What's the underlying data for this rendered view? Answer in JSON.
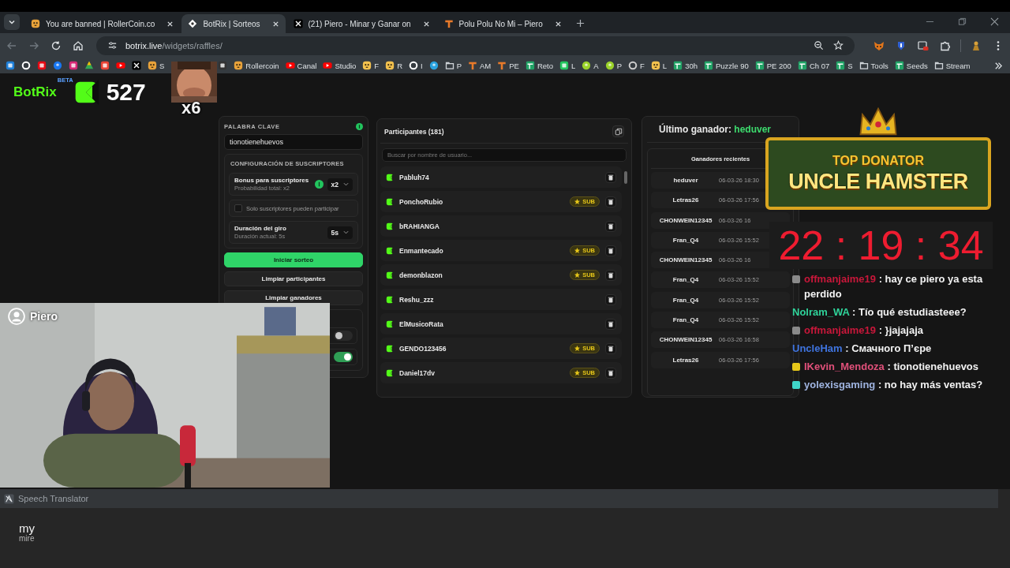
{
  "browser": {
    "tabs": [
      {
        "title": "You are banned | RollerCoin.co",
        "kind": "face",
        "selected": false
      },
      {
        "title": "BotRix | Sorteos",
        "kind": "diamond",
        "selected": true
      },
      {
        "title": "(21) Piero - Minar y Ganar on",
        "kind": "x",
        "selected": false
      },
      {
        "title": "Polu Polu No Mi – Piero",
        "kind": "tee",
        "selected": false
      }
    ],
    "address": {
      "host": "botrix.live",
      "path": "/widgets/raffles/"
    },
    "bookmarks": [
      {
        "kind": "square",
        "color": "#1e7fd8"
      },
      {
        "kind": "ring",
        "color": "#ffffff"
      },
      {
        "kind": "square",
        "color": "#e50914"
      },
      {
        "kind": "circle",
        "color": "#1877f2"
      },
      {
        "kind": "square",
        "color": "#d62976"
      },
      {
        "kind": "triangle",
        "color": "#34a853"
      },
      {
        "kind": "square",
        "color": "#ea4335"
      },
      {
        "kind": "play",
        "color": "#ff0000"
      },
      {
        "kind": "x",
        "color": "#000000"
      },
      {
        "kind": "face",
        "color": "#e8a23a",
        "label": "S"
      },
      {
        "kind": "square",
        "color": "#333333"
      },
      {
        "kind": "face",
        "color": "#e8a23a",
        "label": "Rollercoin"
      },
      {
        "kind": "play",
        "color": "#ff0000",
        "label": "Canal"
      },
      {
        "kind": "play",
        "color": "#ff0000",
        "label": "Studio"
      },
      {
        "kind": "face",
        "color": "#f2c14e",
        "label": "F"
      },
      {
        "kind": "face",
        "color": "#f2c14e",
        "label": "R"
      },
      {
        "kind": "ring",
        "color": "#ffffff",
        "label": "I"
      },
      {
        "kind": "circle",
        "color": "#2aa3e0"
      },
      {
        "kind": "folder",
        "color": "#cfd4d8",
        "label": "P"
      },
      {
        "kind": "tee",
        "color": "#e87a2a",
        "label": "AM"
      },
      {
        "kind": "tee",
        "color": "#e87a2a",
        "label": "PE"
      },
      {
        "kind": "sheet",
        "color": "#21a366",
        "label": "Reto"
      },
      {
        "kind": "square",
        "color": "#22c55e",
        "label": "L"
      },
      {
        "kind": "circle",
        "color": "#9bd32a",
        "label": "A"
      },
      {
        "kind": "circle",
        "color": "#9bd32a",
        "label": "P"
      },
      {
        "kind": "ring",
        "color": "#cccccc",
        "label": "F"
      },
      {
        "kind": "face",
        "color": "#f2c14e",
        "label": "L"
      },
      {
        "kind": "sheet",
        "color": "#21a366",
        "label": "30h"
      },
      {
        "kind": "sheet",
        "color": "#21a366",
        "label": "Puzzle 90"
      },
      {
        "kind": "sheet",
        "color": "#21a366",
        "label": "PE 200"
      },
      {
        "kind": "sheet",
        "color": "#21a366",
        "label": "Ch 07"
      },
      {
        "kind": "sheet",
        "color": "#21a366",
        "label": "S"
      },
      {
        "kind": "folder",
        "color": "#cfd4d8",
        "label": "Tools"
      },
      {
        "kind": "sheet",
        "color": "#21a366",
        "label": "Seeds"
      },
      {
        "kind": "folder",
        "color": "#cfd4d8",
        "label": "Stream"
      }
    ]
  },
  "raffle": {
    "keyword_label": "PALABRA CLAVE",
    "keyword": "tionotienehuevos",
    "subscribers_heading": "CONFIGURACIÓN DE SUSCRIPTORES",
    "options": [
      {
        "kind": "select",
        "title": "Bonus para suscriptores",
        "subtitle": "Probabilidad total: x2",
        "value": "x2",
        "info": true
      },
      {
        "kind": "checkbox",
        "label": "Solo suscriptores pueden participar",
        "checked": false
      },
      {
        "kind": "select",
        "title": "Duración del giro",
        "subtitle": "Duración actual: 5s",
        "value": "5s",
        "info": false
      }
    ],
    "buttons": [
      {
        "label": "Iniciar sorteo",
        "primary": true
      },
      {
        "label": "Limpiar participantes",
        "primary": false
      },
      {
        "label": "Limpiar ganadores",
        "primary": false
      }
    ],
    "toggles": [
      {
        "on": false
      },
      {
        "on": true
      }
    ]
  },
  "participants": {
    "title": "Participantes (181)",
    "search_placeholder": "Buscar por nombre de usuario...",
    "rows": [
      {
        "name": "Pabluh74"
      },
      {
        "name": "PonchoRubio",
        "badge": "SUB"
      },
      {
        "name": "bRAHIANGA"
      },
      {
        "name": "Enmantecado",
        "badge": "SUB"
      },
      {
        "name": "demonblazon",
        "badge": "SUB"
      },
      {
        "name": "Reshu_zzz"
      },
      {
        "name": "ElMusicoRata"
      },
      {
        "name": "GENDO123456",
        "badge": "SUB"
      },
      {
        "name": "Daniel17dv",
        "badge": "SUB"
      }
    ]
  },
  "winners": {
    "last_label": "Último ganador:",
    "last_name": "heduver",
    "recent_title": "Ganadores recientes",
    "rows": [
      {
        "name": "heduver",
        "date": "06-03-26 18:30"
      },
      {
        "name": "Letras26",
        "date": "06-03-26 17:56"
      },
      {
        "name": "CHONWEIN12345",
        "date": "06-03-26 16"
      },
      {
        "name": "Fran_Q4",
        "date": "06-03-26 15:52"
      },
      {
        "name": "CHONWEIN12345",
        "date": "06-03-26 16"
      },
      {
        "name": "Fran_Q4",
        "date": "06-03-26 15:52"
      },
      {
        "name": "Fran_Q4",
        "date": "06-03-26 15:52"
      },
      {
        "name": "Fran_Q4",
        "date": "06-03-26 15:52"
      },
      {
        "name": "CHONWEIN12345",
        "date": "06-03-26 16:58"
      },
      {
        "name": "Letras26",
        "date": "06-03-26 17:56"
      }
    ]
  },
  "overlay": {
    "brand": "BotRix",
    "brand_tag": "BETA",
    "count": "527",
    "emote_multiplier": "x6",
    "streamer": "Piero",
    "donator_title": "TOP DONATOR",
    "donator_name": "UNCLE HAMSTER",
    "timer": "22 : 19 : 34",
    "chat": [
      {
        "user": "offmanjaime19",
        "color": "#c8173a",
        "badge": {
          "color": "#8a8a8a"
        },
        "separator": ":",
        "text": "hay ce piero ya esta perdido"
      },
      {
        "user": "Nolram_WA",
        "color": "#2fd39a",
        "separator": ":",
        "text": "Tío qué estudiasteee?"
      },
      {
        "user": "offmanjaime19",
        "color": "#c8173a",
        "badge": {
          "color": "#8a8a8a"
        },
        "separator": ":",
        "text": "}jajajaja"
      },
      {
        "user": "UncleHam",
        "color": "#3f74e0",
        "separator": ":",
        "text": "Смачного П’єре"
      },
      {
        "user": "IKevin_Mendoza",
        "color": "#e0507a",
        "badge": {
          "color": "#e6c619"
        },
        "separator": ":",
        "text": "tionotienehuevos"
      },
      {
        "user": "yolexisgaming",
        "color": "#9fb4e0",
        "badge": {
          "color": "#3fd6c8"
        },
        "separator": ":",
        "text": "no hay más ventas?"
      }
    ]
  },
  "translator": {
    "title": "Speech Translator",
    "text": "my",
    "translation": "mire"
  }
}
